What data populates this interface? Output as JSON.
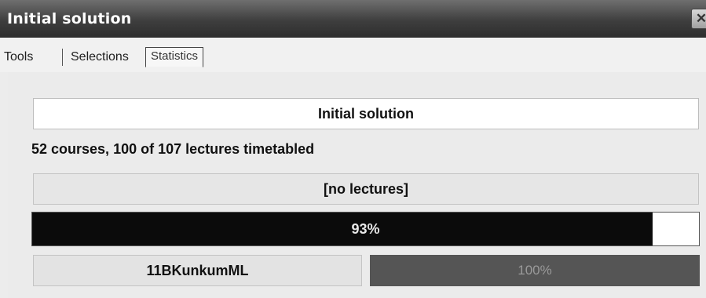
{
  "window": {
    "title": "Initial solution",
    "close_icon": "close-icon"
  },
  "tabs": [
    {
      "label": "Tools"
    },
    {
      "label": "Selections"
    },
    {
      "label": "Statistics",
      "active": true
    }
  ],
  "statistics": {
    "solution_name": "Initial solution",
    "summary": "52 courses, 100 of 107 lectures timetabled",
    "status_message": "[no lectures]",
    "overall_progress": {
      "value": 0.93,
      "label": "93%"
    },
    "course": {
      "name": "11BKunkumML",
      "progress": {
        "value": 1.0,
        "label": "100%"
      }
    }
  },
  "colors": {
    "titlebar": "#3e3e3e",
    "progress_fill": "#0b0b0b",
    "course_progress_fill": "#555555"
  }
}
